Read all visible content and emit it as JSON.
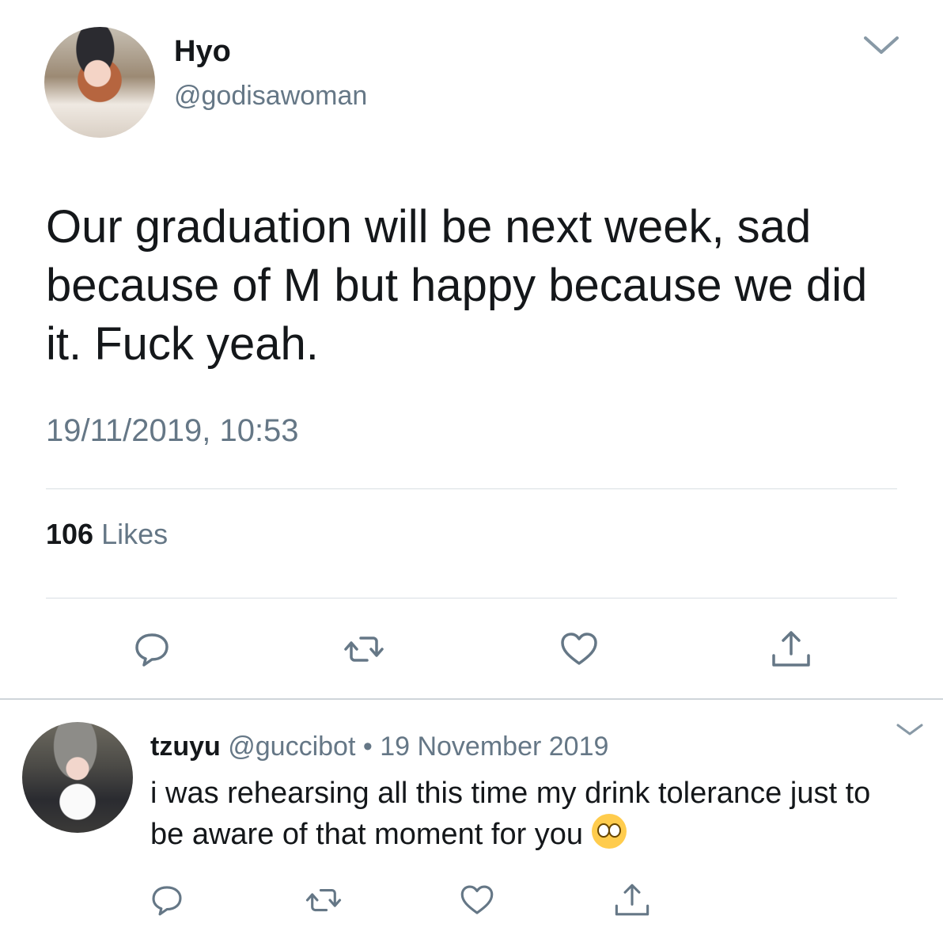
{
  "tweet": {
    "display_name": "Hyo",
    "handle": "@godisawoman",
    "text": "Our graduation will be next week, sad because of M but happy because we did it. Fuck yeah.",
    "timestamp": "19/11/2019, 10:53",
    "likes_count": "106",
    "likes_label": "Likes",
    "icons": [
      "reply-icon",
      "retweet-icon",
      "like-icon",
      "share-icon"
    ]
  },
  "reply": {
    "display_name": "tzuyu",
    "handle": "@guccibot",
    "separator": "•",
    "date": "19 November 2019",
    "text": "i was rehearsing all this time my drink tolerance just to be aware of that moment for you",
    "emoji": "pleading-face-emoji",
    "icons": [
      "reply-icon",
      "retweet-icon",
      "like-icon",
      "share-icon"
    ]
  },
  "colors": {
    "text_primary": "#14171a",
    "text_secondary": "#657786",
    "divider": "#d8dee3"
  }
}
